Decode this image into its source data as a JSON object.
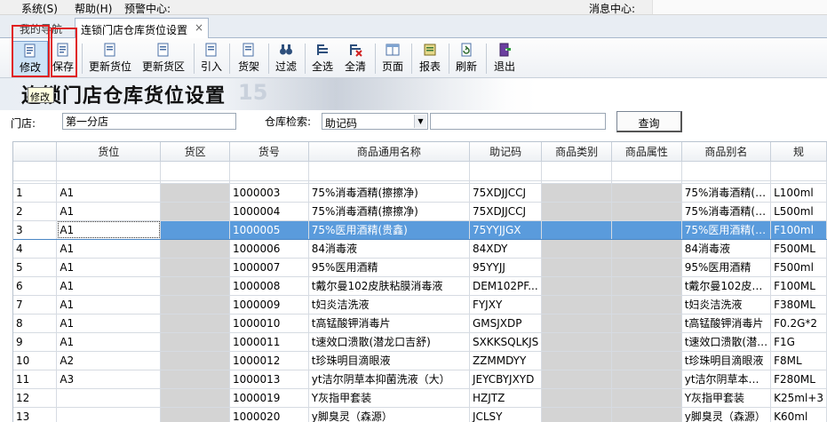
{
  "menu": {
    "items": [
      "系统(S)",
      "帮助(H)",
      "预警中心:"
    ],
    "notice_label": "消息中心:"
  },
  "tabs": {
    "inactive": "我的导航",
    "active": "连锁门店仓库货位设置",
    "close": "×"
  },
  "toolbar": {
    "buttons": [
      {
        "label": "修改",
        "icon": "edit-icon"
      },
      {
        "label": "保存",
        "icon": "save-icon"
      },
      {
        "label": "更新货位",
        "icon": "update-location-icon"
      },
      {
        "label": "更新货区",
        "icon": "update-area-icon"
      },
      {
        "label": "引入",
        "icon": "import-icon"
      },
      {
        "label": "货架",
        "icon": "shelf-icon"
      },
      {
        "label": "过滤",
        "icon": "binoculars-icon"
      },
      {
        "label": "全选",
        "icon": "select-all-icon"
      },
      {
        "label": "全清",
        "icon": "clear-all-icon"
      },
      {
        "label": "页面",
        "icon": "page-icon"
      },
      {
        "label": "报表",
        "icon": "report-icon"
      },
      {
        "label": "刷新",
        "icon": "refresh-icon"
      },
      {
        "label": "退出",
        "icon": "exit-icon"
      }
    ],
    "tooltip": "修改"
  },
  "banner": {
    "title": "连锁门店仓库货位设置",
    "deco_number": "15"
  },
  "filter": {
    "store_label": "门店:",
    "store_value": "第一分店",
    "search_label": "仓库检索:",
    "search_mode": "助记码",
    "keyword": "",
    "query_button": "查询"
  },
  "grid": {
    "columns": [
      "",
      "货位",
      "货区",
      "货号",
      "商品通用名称",
      "助记码",
      "商品类别",
      "商品属性",
      "商品别名",
      "规"
    ],
    "selected_row": 3,
    "rows": [
      {
        "no": "1",
        "loc": "A1",
        "area": "",
        "code": "1000003",
        "name": "75%消毒酒精(擦擦净)",
        "mnemonic": "75XDJJCCJ",
        "cat": "",
        "attr": "",
        "alias": "75%消毒酒精(…",
        "spec": "L100ml"
      },
      {
        "no": "2",
        "loc": "A1",
        "area": "",
        "code": "1000004",
        "name": "75%消毒酒精(擦擦净)",
        "mnemonic": "75XDJJCCJ",
        "cat": "",
        "attr": "",
        "alias": "75%消毒酒精(…",
        "spec": "L500ml"
      },
      {
        "no": "3",
        "loc": "A1",
        "area": "",
        "code": "1000005",
        "name": "75%医用酒精(贵鑫)",
        "mnemonic": "75YYJJGX",
        "cat": "",
        "attr": "",
        "alias": "75%医用酒精(…",
        "spec": "F100ml"
      },
      {
        "no": "4",
        "loc": "A1",
        "area": "",
        "code": "1000006",
        "name": "84消毒液",
        "mnemonic": "84XDY",
        "cat": "",
        "attr": "",
        "alias": "84消毒液",
        "spec": "F500ML"
      },
      {
        "no": "5",
        "loc": "A1",
        "area": "",
        "code": "1000007",
        "name": "95%医用酒精",
        "mnemonic": "95YYJJ",
        "cat": "",
        "attr": "",
        "alias": "95%医用酒精",
        "spec": "F500ml"
      },
      {
        "no": "6",
        "loc": "A1",
        "area": "",
        "code": "1000008",
        "name": "t戴尔曼102皮肤粘膜消毒液",
        "mnemonic": "DEM102PF...",
        "cat": "",
        "attr": "",
        "alias": "t戴尔曼102皮…",
        "spec": "F100ML"
      },
      {
        "no": "7",
        "loc": "A1",
        "area": "",
        "code": "1000009",
        "name": "t妇炎洁洗液",
        "mnemonic": "FYJXY",
        "cat": "",
        "attr": "",
        "alias": "t妇炎洁洗液",
        "spec": "F380ML"
      },
      {
        "no": "8",
        "loc": "A1",
        "area": "",
        "code": "1000010",
        "name": "t高锰酸钾消毒片",
        "mnemonic": "GMSJXDP",
        "cat": "",
        "attr": "",
        "alias": "t高锰酸钾消毒片",
        "spec": "F0.2G*2"
      },
      {
        "no": "9",
        "loc": "A1",
        "area": "",
        "code": "1000011",
        "name": "t速效口溃散(潜龙口吉舒)",
        "mnemonic": "SXKKSQLKJS",
        "cat": "",
        "attr": "",
        "alias": "t速效口溃散(潜…",
        "spec": "F1G"
      },
      {
        "no": "10",
        "loc": "A2",
        "area": "",
        "code": "1000012",
        "name": "t珍珠明目滴眼液",
        "mnemonic": "ZZMMDYY",
        "cat": "",
        "attr": "",
        "alias": "t珍珠明目滴眼液",
        "spec": "F8ML"
      },
      {
        "no": "11",
        "loc": "A3",
        "area": "",
        "code": "1000013",
        "name": "yt洁尔阴草本抑菌洗液（大）",
        "mnemonic": "JEYCBYJXYD",
        "cat": "",
        "attr": "",
        "alias": "yt洁尔阴草本…",
        "spec": "F280ML"
      },
      {
        "no": "12",
        "loc": "",
        "area": "",
        "code": "1000019",
        "name": "Y灰指甲套装",
        "mnemonic": "HZJTZ",
        "cat": "",
        "attr": "",
        "alias": "Y灰指甲套装",
        "spec": "K25ml+3"
      },
      {
        "no": "13",
        "loc": "",
        "area": "",
        "code": "1000020",
        "name": "y脚臭灵（森源）",
        "mnemonic": "JCLSY",
        "cat": "",
        "attr": "",
        "alias": "y脚臭灵（森源）",
        "spec": "K60ml"
      }
    ]
  },
  "colors": {
    "selection": "#5a9bdc",
    "highlight_box": "#e02020",
    "gray_cell": "#d4d4d4"
  }
}
